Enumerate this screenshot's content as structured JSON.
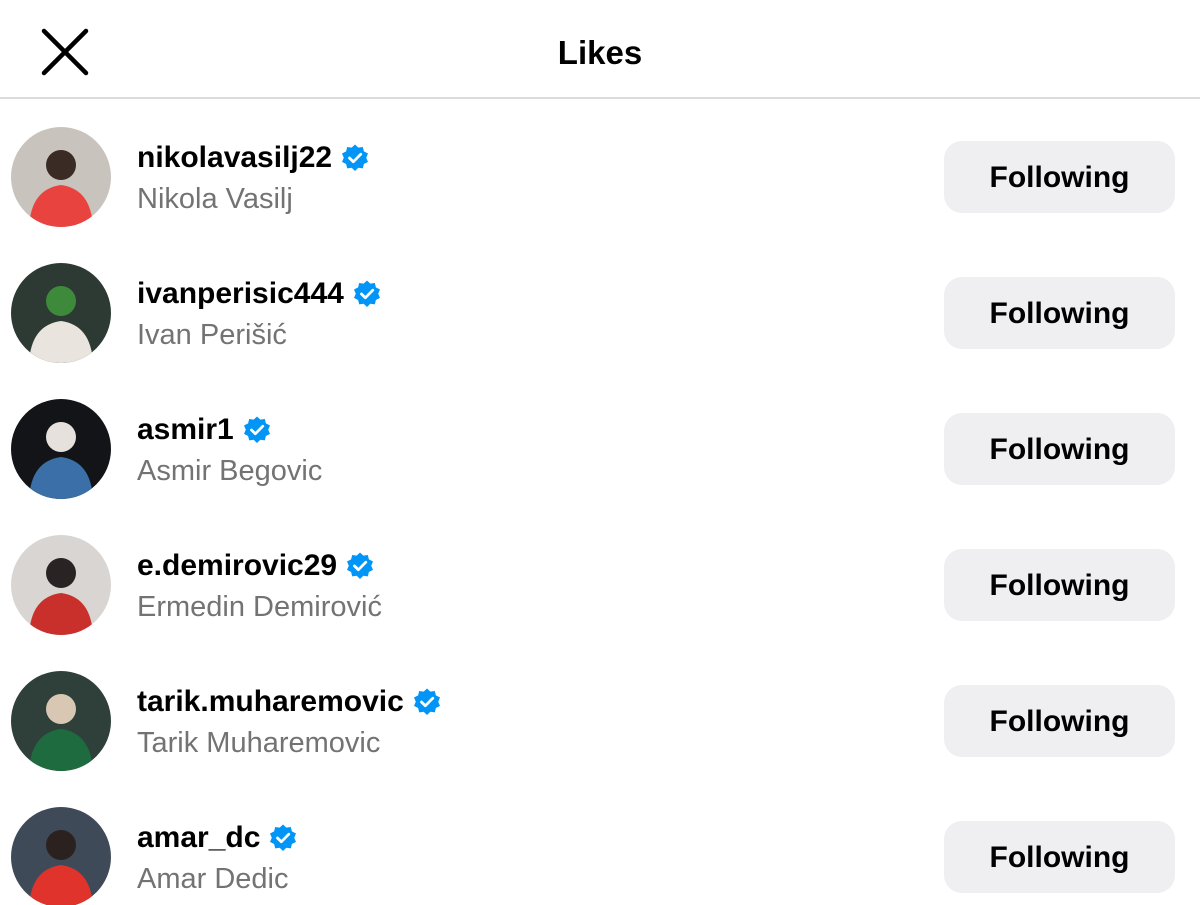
{
  "header": {
    "title": "Likes",
    "close_icon": "close-icon"
  },
  "colors": {
    "verified_blue": "#0095f6",
    "button_bg": "#efeff2",
    "secondary_text": "#737373",
    "divider": "#dbdbdb"
  },
  "likes": [
    {
      "username": "nikolavasilj22",
      "full_name": "Nikola Vasilj",
      "verified": true,
      "button_label": "Following",
      "avatar_palette": [
        "#c9c3bd",
        "#e8433f",
        "#3a2b24"
      ]
    },
    {
      "username": "ivanperisic444",
      "full_name": "Ivan Perišić",
      "verified": true,
      "button_label": "Following",
      "avatar_palette": [
        "#2d3a33",
        "#e9e4de",
        "#3d8a3a"
      ]
    },
    {
      "username": "asmir1",
      "full_name": "Asmir Begovic",
      "verified": true,
      "button_label": "Following",
      "avatar_palette": [
        "#121417",
        "#3b6fa8",
        "#e6e1dc"
      ]
    },
    {
      "username": "e.demirovic29",
      "full_name": "Ermedin Demirović",
      "verified": true,
      "button_label": "Following",
      "avatar_palette": [
        "#d9d5d2",
        "#c9302c",
        "#2a2323"
      ]
    },
    {
      "username": "tarik.muharemovic",
      "full_name": "Tarik Muharemovic",
      "verified": true,
      "button_label": "Following",
      "avatar_palette": [
        "#2f3f3a",
        "#1e6b3f",
        "#d8c7b3"
      ]
    },
    {
      "username": "amar_dc",
      "full_name": "Amar Dedic",
      "verified": true,
      "button_label": "Following",
      "avatar_palette": [
        "#3f4a58",
        "#e0332c",
        "#2b2220"
      ]
    }
  ]
}
